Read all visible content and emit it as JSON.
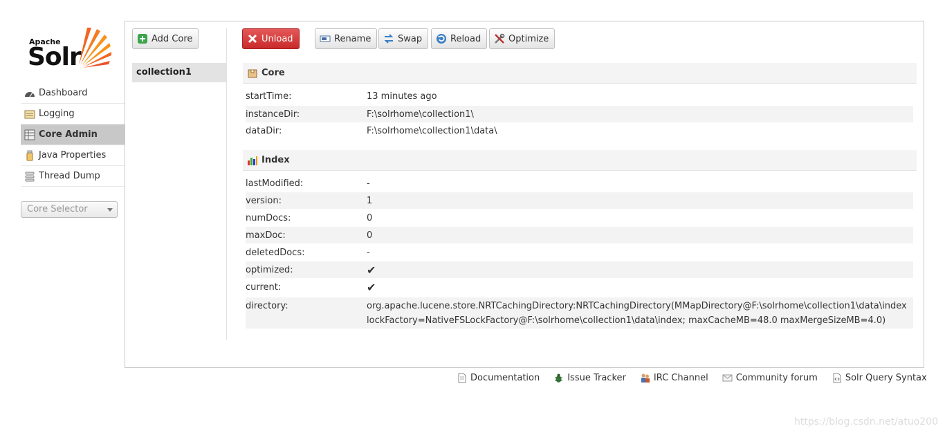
{
  "logo": {
    "apache": "Apache",
    "solr": "Solr"
  },
  "nav": {
    "items": [
      {
        "label": "Dashboard",
        "icon": "dashboard-icon",
        "active": false
      },
      {
        "label": "Logging",
        "icon": "logging-icon",
        "active": false
      },
      {
        "label": "Core Admin",
        "icon": "core-admin-icon",
        "active": true
      },
      {
        "label": "Java Properties",
        "icon": "java-properties-icon",
        "active": false
      },
      {
        "label": "Thread Dump",
        "icon": "thread-dump-icon",
        "active": false
      }
    ],
    "core_selector": "Core Selector"
  },
  "toolbar": {
    "add_core": "Add Core",
    "unload": "Unload",
    "rename": "Rename",
    "swap": "Swap",
    "reload": "Reload",
    "optimize": "Optimize"
  },
  "cores": [
    "collection1"
  ],
  "core_section": {
    "title": "Core",
    "rows": [
      {
        "key": "startTime:",
        "value": "13 minutes ago"
      },
      {
        "key": "instanceDir:",
        "value": "F:\\solrhome\\collection1\\"
      },
      {
        "key": "dataDir:",
        "value": "F:\\solrhome\\collection1\\data\\"
      }
    ]
  },
  "index_section": {
    "title": "Index",
    "rows": [
      {
        "key": "lastModified:",
        "value": "-"
      },
      {
        "key": "version:",
        "value": "1"
      },
      {
        "key": "numDocs:",
        "value": "0"
      },
      {
        "key": "maxDoc:",
        "value": "0"
      },
      {
        "key": "deletedDocs:",
        "value": "-"
      },
      {
        "key": "optimized:",
        "value": "✔"
      },
      {
        "key": "current:",
        "value": "✔"
      },
      {
        "key": "directory:",
        "value": "org.apache.lucene.store.NRTCachingDirectory:NRTCachingDirectory(MMapDirectory@F:\\solrhome\\collection1\\data\\index lockFactory=NativeFSLockFactory@F:\\solrhome\\collection1\\data\\index; maxCacheMB=48.0 maxMergeSizeMB=4.0)"
      }
    ]
  },
  "footer": {
    "links": [
      "Documentation",
      "Issue Tracker",
      "IRC Channel",
      "Community forum",
      "Solr Query Syntax"
    ]
  },
  "watermark": "https://blog.csdn.net/atuo200",
  "colors": {
    "unload": "#d33a3a",
    "check": "#2ca02c",
    "active_nav": "#c8c8c8"
  }
}
